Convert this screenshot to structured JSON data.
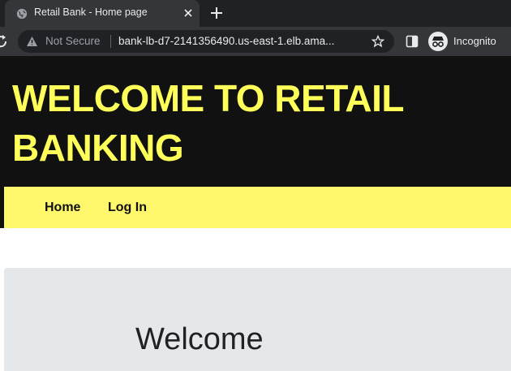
{
  "browser": {
    "tab_title": "Retail Bank - Home page",
    "security_label": "Not Secure",
    "url": "bank-lb-d7-2141356490.us-east-1.elb.ama...",
    "incognito_label": "Incognito",
    "icons": [
      "globe-icon",
      "close-icon",
      "plus-icon",
      "reload-icon",
      "warning-icon",
      "star-icon",
      "side-panel-icon",
      "incognito-icon"
    ]
  },
  "header": {
    "title": "WELCOME TO RETAIL BANKING",
    "color": "#ffff5a",
    "background": "#111111"
  },
  "nav": {
    "items": [
      {
        "label": "Home"
      },
      {
        "label": "Log In"
      }
    ],
    "background": "#fff86d"
  },
  "main": {
    "welcome_heading": "Welcome",
    "panel_background": "#e5e8eb"
  }
}
